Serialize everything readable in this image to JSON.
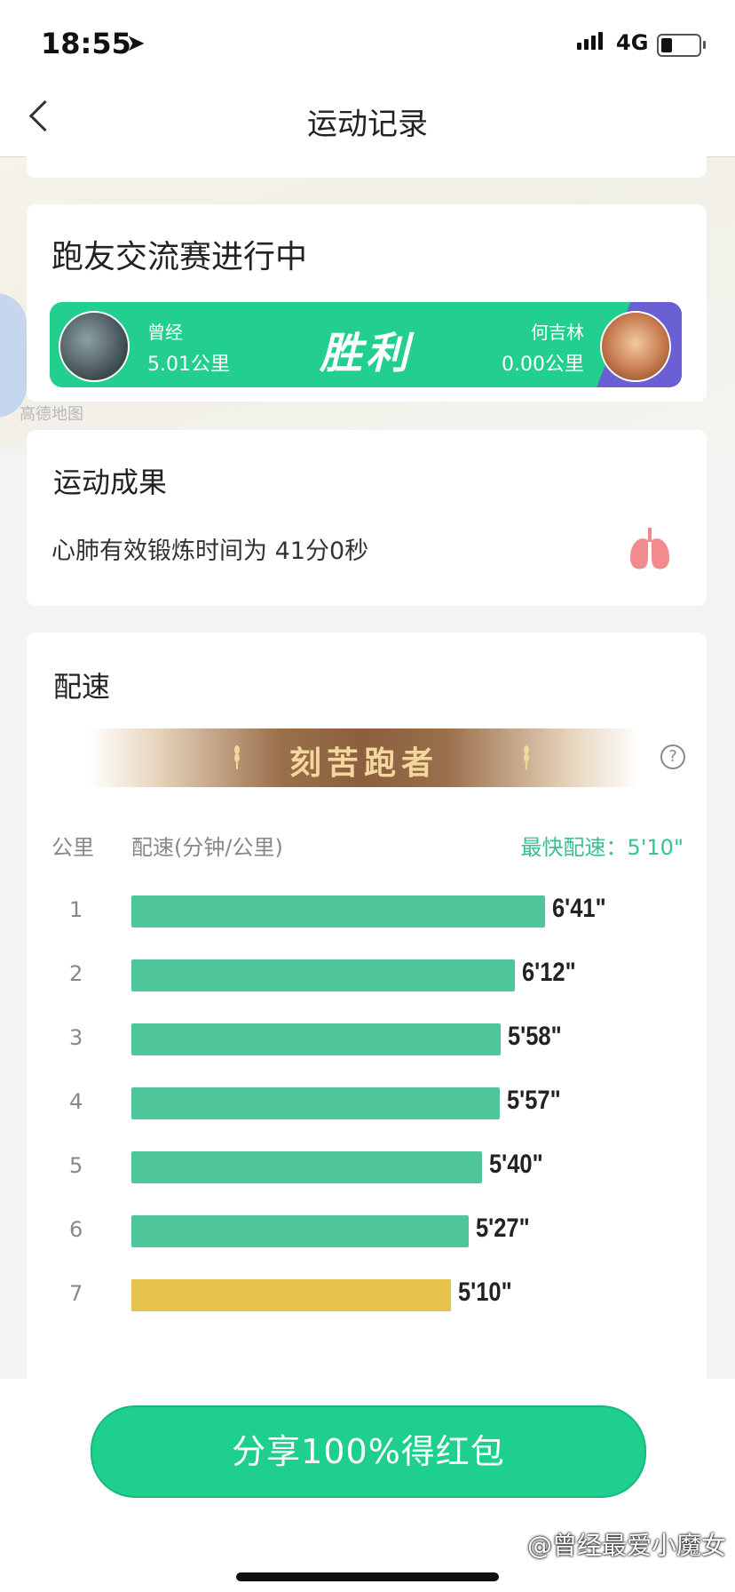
{
  "status_bar": {
    "time": "18:55",
    "location_glyph": "➤",
    "network": "4G"
  },
  "nav": {
    "title": "运动记录"
  },
  "map": {
    "logo_text": "高德地图"
  },
  "race": {
    "title": "跑友交流赛进行中",
    "left_runner": {
      "name": "曾经",
      "distance": "5.01公里"
    },
    "right_runner": {
      "name": "何吉林",
      "distance": "0.00公里"
    },
    "result_label": "胜利",
    "colors": {
      "banner": "#23cf8e",
      "opponent": "#6b5fd4"
    }
  },
  "result": {
    "title": "运动成果",
    "text": "心肺有效锻炼时间为 41分0秒",
    "icon": "lungs-icon"
  },
  "pace": {
    "title": "配速",
    "badge": "刻苦跑者",
    "help_glyph": "?",
    "col_km": "公里",
    "col_pace": "配速(分钟/公里)",
    "fastest": "最快配速：5'10\"",
    "rows": [
      {
        "km": "1",
        "pace": "6'41\"",
        "seconds": 401,
        "color": "#4fc699"
      },
      {
        "km": "2",
        "pace": "6'12\"",
        "seconds": 372,
        "color": "#4fc699"
      },
      {
        "km": "3",
        "pace": "5'58\"",
        "seconds": 358,
        "color": "#4fc699"
      },
      {
        "km": "4",
        "pace": "5'57\"",
        "seconds": 357,
        "color": "#4fc699"
      },
      {
        "km": "5",
        "pace": "5'40\"",
        "seconds": 340,
        "color": "#4fc699"
      },
      {
        "km": "6",
        "pace": "5'27\"",
        "seconds": 327,
        "color": "#4fc699"
      },
      {
        "km": "7",
        "pace": "5'10\"",
        "seconds": 310,
        "color": "#e8c24f"
      }
    ]
  },
  "share": {
    "label": "分享100%得红包"
  },
  "watermark": "@曾经最爱小魔女"
}
